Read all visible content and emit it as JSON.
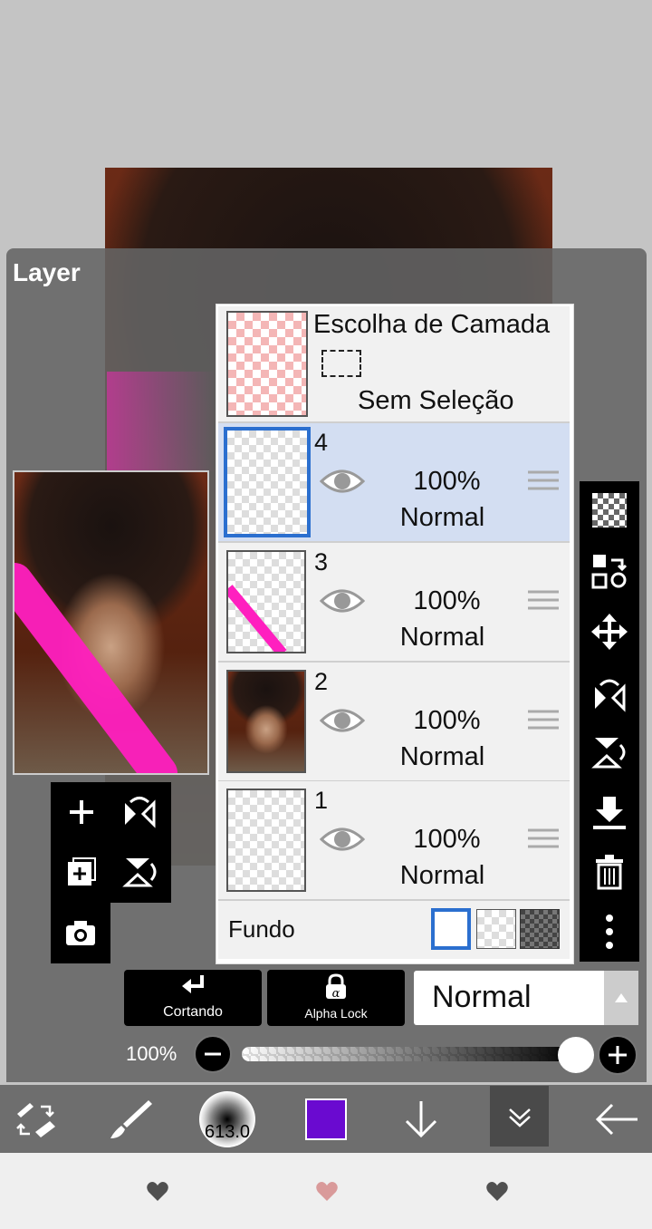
{
  "panel": {
    "title": "Layer"
  },
  "selection_layer": {
    "title": "Escolha de Camada",
    "status": "Sem Seleção"
  },
  "layers": [
    {
      "number": "4",
      "opacity": "100%",
      "mode": "Normal",
      "selected": true
    },
    {
      "number": "3",
      "opacity": "100%",
      "mode": "Normal",
      "selected": false
    },
    {
      "number": "2",
      "opacity": "100%",
      "mode": "Normal",
      "selected": false
    },
    {
      "number": "1",
      "opacity": "100%",
      "mode": "Normal",
      "selected": false
    }
  ],
  "background": {
    "label": "Fundo"
  },
  "controls": {
    "clipping_label": "Cortando",
    "alpha_lock_label": "Alpha Lock",
    "blend_mode": "Normal",
    "opacity_label": "100%",
    "opacity_value": 1.0
  },
  "toolbar": {
    "brush_size": "613.0",
    "color": "#6a0ad0"
  },
  "colors": {
    "accent": "#2b6fcf",
    "magenta": "#ff1fbf"
  },
  "nav": {
    "heart_icons": [
      "heart-icon",
      "heart-icon",
      "heart-icon"
    ]
  }
}
